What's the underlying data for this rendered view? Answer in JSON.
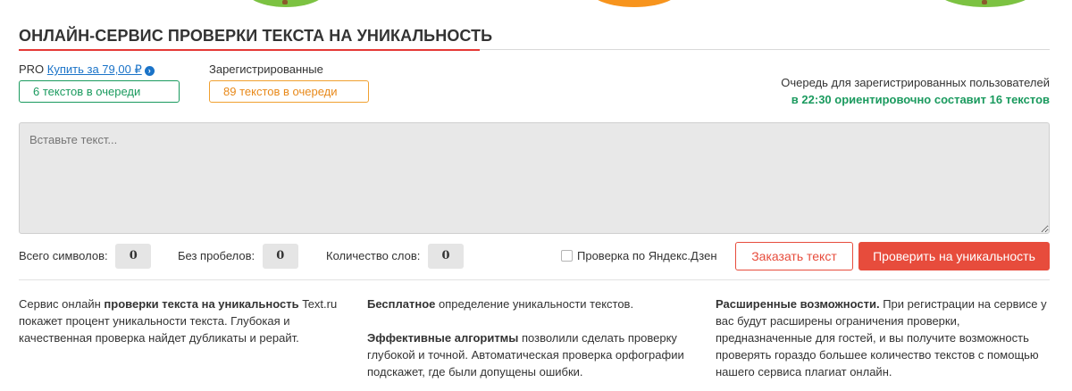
{
  "title": "ОНЛАЙН-СЕРВИС ПРОВЕРКИ ТЕКСТА НА УНИКАЛЬНОСТЬ",
  "pro": {
    "label": "PRO",
    "buy_link": "Купить за 79,00 ₽"
  },
  "registered_label": "Зарегистрированные",
  "queue": {
    "pro_count": "6 текстов в очереди",
    "registered_count": "89 текстов в очереди"
  },
  "queue_note": {
    "line1": "Очередь для зарегистрированных пользователей",
    "line2": "в 22:30 ориентировочно составит 16 текстов"
  },
  "textarea": {
    "placeholder": "Вставьте текст..."
  },
  "stats": {
    "total_label": "Всего символов:",
    "total_value": "0",
    "no_spaces_label": "Без пробелов:",
    "no_spaces_value": "0",
    "words_label": "Количество слов:",
    "words_value": "0"
  },
  "yandex_check_label": "Проверка по Яндекс.Дзен",
  "buttons": {
    "order": "Заказать текст",
    "check": "Проверить на уникальность"
  },
  "info": {
    "col1": {
      "pre": "Сервис онлайн ",
      "bold": "проверки текста на уникальность",
      "rest": " Text.ru покажет процент уникальности текста. Глубокая и качественная проверка найдет дубликаты и рерайт."
    },
    "col2": {
      "p1_bold": "Бесплатное",
      "p1_rest": " определение уникальности текстов.",
      "p2_bold": "Эффективные алгоритмы",
      "p2_rest": " позволили сделать проверку глубокой и точной. Автоматическая проверка орфографии подскажет, где были допущены ошибки."
    },
    "col3": {
      "bold": "Расширенные возможности.",
      "rest": " При регистрации на сервисе у вас будут расширены ограничения проверки, предназначенные для гостей, и вы получите возможность проверять гораздо большее количество текстов с помощью нашего сервиса плагиат онлайн."
    }
  },
  "colors": {
    "accent_red": "#e74c3c",
    "green": "#1a9a5e",
    "orange": "#e8891a",
    "link_blue": "#1a73c8"
  }
}
